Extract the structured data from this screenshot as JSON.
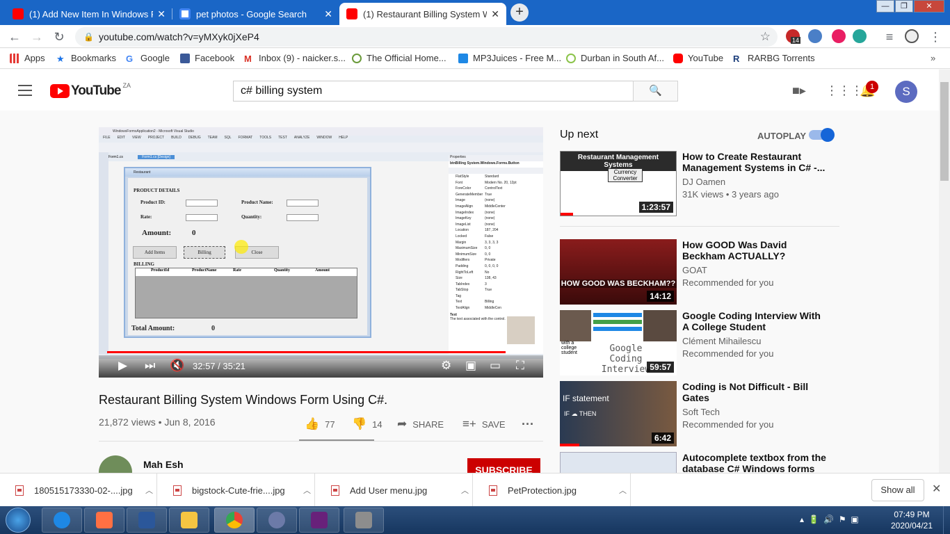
{
  "browser": {
    "tabs": [
      {
        "title": "(1) Add New Item In Windows PC",
        "favicon_color": "#ff0000"
      },
      {
        "title": "pet photos - Google Search",
        "favicon_color": "#4285f4"
      },
      {
        "title": "(1) Restaurant Billing System Win",
        "favicon_color": "#ff0000"
      }
    ],
    "url": "youtube.com/watch?v=yMXyk0jXeP4",
    "extension_badge": "14",
    "bookmarks": [
      "Apps",
      "Bookmarks",
      "Google",
      "Facebook",
      "Inbox (9) - naicker.s...",
      "The Official Home...",
      "MP3Juices - Free M...",
      "Durban in South Af...",
      "YouTube",
      "RARBG Torrents"
    ]
  },
  "youtube": {
    "logo_text": "YouTube",
    "region": "ZA",
    "search_query": "c# billing system",
    "notif_count": "1",
    "avatar_letter": "S"
  },
  "video_screen": {
    "vs_title": "WindowsFormsApplication2 - Microsoft Visual Studio",
    "menu": [
      "FILE",
      "EDIT",
      "VIEW",
      "PROJECT",
      "BUILD",
      "DEBUG",
      "TEAM",
      "SQL",
      "FORMAT",
      "TOOLS",
      "TEST",
      "ANALYZE",
      "WINDOW",
      "HELP"
    ],
    "tabs": [
      "Form1.cs",
      "Form1.cs [Design]"
    ],
    "form_title": "Restaurant",
    "product_details": "PRODUCT DETAILS",
    "product_id": "Product ID:",
    "product_name": "Product Name:",
    "rate": "Rate:",
    "quantity": "Quantity:",
    "amount": "Amount:",
    "amount_value": "0",
    "btn_add": "Add Items",
    "btn_billing": "Billing",
    "btn_close": "Close",
    "billing": "BILLING",
    "grid_cols": [
      "ProductId",
      "ProductName",
      "Rate",
      "Quantity",
      "Amount"
    ],
    "total_amount": "Total Amount:",
    "total_value": "0",
    "props_header": "Properties",
    "props_object": "btnBilling  System.Windows.Forms.Button",
    "props": [
      [
        "FlatStyle",
        "Standard"
      ],
      [
        "Font",
        "Modern No. 20, 12pt"
      ],
      [
        "ForeColor",
        "ControlText"
      ],
      [
        "GenerateMember",
        "True"
      ],
      [
        "Image",
        "(none)"
      ],
      [
        "ImageAlign",
        "MiddleCenter"
      ],
      [
        "ImageIndex",
        "(none)"
      ],
      [
        "ImageKey",
        "(none)"
      ],
      [
        "ImageList",
        "(none)"
      ],
      [
        "Location",
        "187, 204"
      ],
      [
        "Locked",
        "False"
      ],
      [
        "Margin",
        "3, 3, 3, 3"
      ],
      [
        "MaximumSize",
        "0, 0"
      ],
      [
        "MinimumSize",
        "0, 0"
      ],
      [
        "Modifiers",
        "Private"
      ],
      [
        "Padding",
        "0, 0, 0, 0"
      ],
      [
        "RightToLeft",
        "No"
      ],
      [
        "Size",
        "138, 43"
      ],
      [
        "TabIndex",
        "3"
      ],
      [
        "TabStop",
        "True"
      ],
      [
        "Tag",
        ""
      ],
      [
        "Text",
        "Billing"
      ],
      [
        "TextAlign",
        "MiddleCen"
      ]
    ],
    "props_desc_title": "Text",
    "props_desc": "The text associated with the control."
  },
  "player": {
    "time": "32:57 / 35:21",
    "progress": 0.932
  },
  "video": {
    "title": "Restaurant Billing System Windows Form Using C#.",
    "meta": "21,872 views • Jun 8, 2016",
    "likes": "77",
    "dislikes": "14",
    "share": "SHARE",
    "save": "SAVE",
    "channel": "Mah Esh",
    "subscribe": "SUBSCRIBE"
  },
  "sidebar": {
    "up_next": "Up next",
    "autoplay": "AUTOPLAY",
    "items": [
      {
        "title": "How to Create Restaurant Management Systems in C# -...",
        "channel": "DJ Oamen",
        "meta": "31K views • 3 years ago",
        "duration": "1:23:57",
        "thumb_text": "Restaurant Management Systems",
        "thumb_sub": "Currency Converter"
      },
      {
        "title": "How GOOD Was David Beckham ACTUALLY?",
        "channel": "GOAT",
        "meta": "Recommended for you",
        "duration": "14:12",
        "thumb_text": "HOW GOOD WAS BECKHAM??"
      },
      {
        "title": "Google Coding Interview With A College Student",
        "channel": "Clément Mihailescu",
        "meta": "Recommended for you",
        "duration": "59:57",
        "thumb_text": "Google Coding Interview",
        "thumb_sub": "with a college student"
      },
      {
        "title": "Coding is Not Difficult - Bill Gates",
        "channel": "Soft Tech",
        "meta": "Recommended for you",
        "duration": "6:42",
        "thumb_text": "IF statement",
        "thumb_sub": "IF ☁ THEN"
      },
      {
        "title": "Autocomplete textbox from the database C# Windows forms"
      }
    ]
  },
  "downloads": {
    "files": [
      "180515173330-02-....jpg",
      "bigstock-Cute-frie....jpg",
      "Add User menu.jpg",
      "PetProtection.jpg"
    ],
    "show_all": "Show all"
  },
  "taskbar": {
    "time": "07:49 PM",
    "date": "2020/04/21"
  }
}
